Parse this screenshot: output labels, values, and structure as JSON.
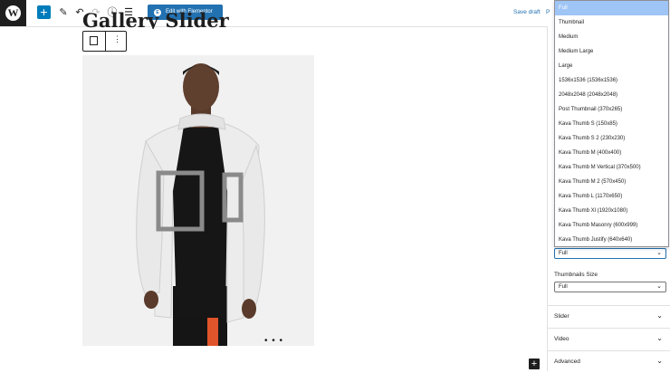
{
  "toolbar": {
    "add_label": "+",
    "edit_elementor_label": "Edit with Elementor",
    "save_draft_label": "Save draft",
    "preview_label": "P"
  },
  "post": {
    "title": "Gallery Slider"
  },
  "block": {
    "more_label": "⋮",
    "gallery_dots": "• • •",
    "inserter_label": "+"
  },
  "dropdown": {
    "options": [
      "Full",
      "Thumbnail",
      "Medium",
      "Medium Large",
      "Large",
      "1536x1536 (1536x1536)",
      "2048x2048 (2048x2048)",
      "Post Thumbnail (370x265)",
      "Kava Thumb S (150x85)",
      "Kava Thumb S 2 (230x230)",
      "Kava Thumb M (400x400)",
      "Kava Thumb M Vertical (370x500)",
      "Kava Thumb M 2 (570x450)",
      "Kava Thumb L (1170x650)",
      "Kava Thumb Xl (1920x1080)",
      "Kava Thumb Masonry (600x999)",
      "Kava Thumb Justify (640x640)"
    ],
    "selected": "Full"
  },
  "sidebar": {
    "image_size_value": "Full",
    "thumbnails_size_label": "Thumbnails Size",
    "thumbnails_size_value": "Full",
    "panels": [
      "Slider",
      "Video",
      "Advanced"
    ]
  },
  "colors": {
    "accent": "#2271b1",
    "add_button": "#007cba",
    "dropdown_selected": "#9fc4f6"
  }
}
